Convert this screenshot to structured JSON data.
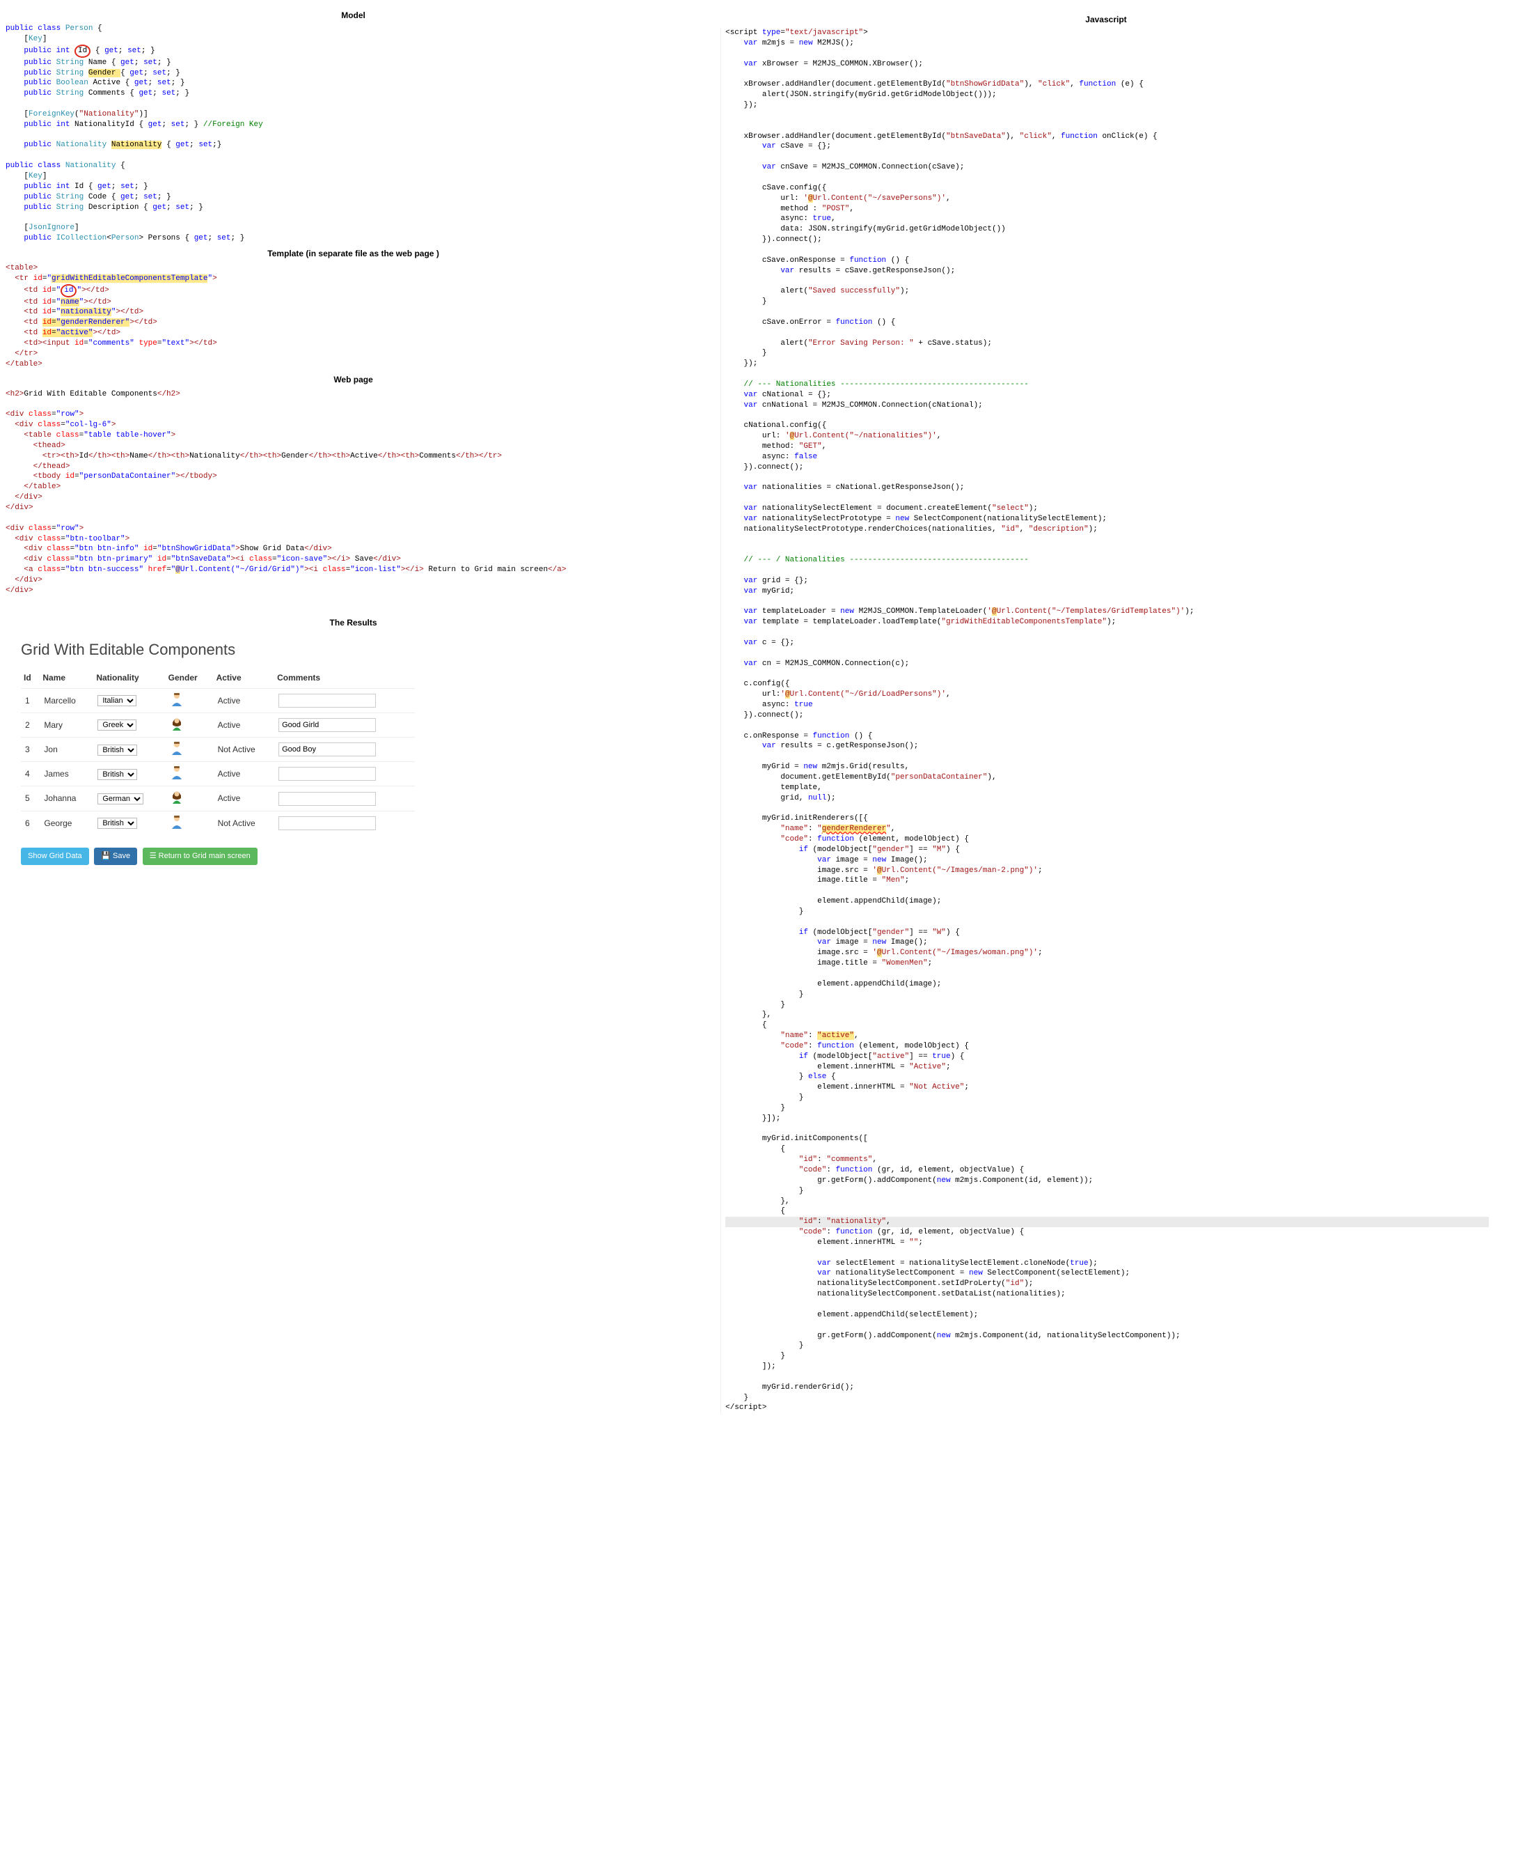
{
  "headings": {
    "model": "Model",
    "template": "Template (in separate file as the web page )",
    "webpage": "Web page",
    "results": "The Results",
    "javascript": "Javascript"
  },
  "model_code": {
    "l1": "public class Person {",
    "l2": "    [Key]",
    "l3a": "    public int ",
    "l3id": "Id",
    "l3b": " { get; set; }",
    "l4": "    public String Name { get; set; }",
    "l5a": "    public String ",
    "l5g": "Gender ",
    "l5b": "{ get; set; }",
    "l6": "    public Boolean Active { get; set; }",
    "l7": "    public String Comments { get; set; }",
    "l8": "    [ForeignKey(\"Nationality\")]",
    "l9": "    public int NationalityId { get; set; } //Foreign Key",
    "l10a": "    public Nationality ",
    "l10b": "Nationality",
    "l10c": " { get; set;}",
    "l11": "public class Nationality {",
    "l12": "    [Key]",
    "l13": "    public int Id { get; set; }",
    "l14": "    public String Code { get; set; }",
    "l15": "    public String Description { get; set; }",
    "l16": "    [JsonIgnore]",
    "l17": "    public ICollection<Person> Persons { get; set; }"
  },
  "template_code": {
    "t1": "<table>",
    "t2": "  <tr id=\"gridWithEditableComponentsTemplate\">",
    "t3a": "    <td id=\"",
    "t3id": "id",
    "t3b": "\"></td>",
    "t4": "    <td id=\"name\"></td>",
    "t5": "    <td id=\"nationality\"></td>",
    "t6": "    <td id=\"genderRenderer\"></td>",
    "t7": "    <td id=\"active\"></td>",
    "t8": "    <td><input id=\"comments\" type=\"text\"></td>",
    "t9": "  </tr>",
    "t10": "</table>"
  },
  "webpage_code": {
    "w1": "<h2>Grid With Editable Components</h2>",
    "w2": "<div class=\"row\">",
    "w3": "  <div class=\"col-lg-6\">",
    "w4": "    <table class=\"table table-hover\">",
    "w5": "      <thead>",
    "w6": "        <tr><th>Id</th><th>Name</th><th>Nationality</th><th>Gender</th><th>Active</th><th>Comments</th></tr>",
    "w7": "      </thead>",
    "w8": "      <tbody id=\"personDataContainer\"></tbody>",
    "w9": "    </table>",
    "w10": "  </div>",
    "w11": "</div>",
    "w12": "<div class=\"row\">",
    "w13": "  <div class=\"btn-toolbar\">",
    "w14": "    <div class=\"btn btn-info\" id=\"btnShowGridData\">Show Grid Data</div>",
    "w15": "    <div class=\"btn btn-primary\" id=\"btnSaveData\"><i class=\"icon-save\"></i> Save</div>",
    "w16": "    <a class=\"btn btn-success\" href=\"@Url.Content(\"~/Grid/Grid\")\"><i class=\"icon-list\"></i> Return to Grid main screen</a>",
    "w17": "  </div>",
    "w18": "</div>"
  },
  "results": {
    "title": "Grid With Editable Components",
    "columns": [
      "Id",
      "Name",
      "Nationality",
      "Gender",
      "Active",
      "Comments"
    ],
    "rows": [
      {
        "id": "1",
        "name": "Marcello",
        "nat": "Italian",
        "gender": "M",
        "active": "Active",
        "comment": ""
      },
      {
        "id": "2",
        "name": "Mary",
        "nat": "Greek",
        "gender": "W",
        "active": "Active",
        "comment": "Good Girld"
      },
      {
        "id": "3",
        "name": "Jon",
        "nat": "British",
        "gender": "M",
        "active": "Not Active",
        "comment": "Good Boy"
      },
      {
        "id": "4",
        "name": "James",
        "nat": "British",
        "gender": "M",
        "active": "Active",
        "comment": ""
      },
      {
        "id": "5",
        "name": "Johanna",
        "nat": "German",
        "gender": "W",
        "active": "Active",
        "comment": ""
      },
      {
        "id": "6",
        "name": "George",
        "nat": "British",
        "gender": "M",
        "active": "Not Active",
        "comment": ""
      }
    ],
    "buttons": {
      "show": "Show Grid Data",
      "save": " Save",
      "return": " Return to Grid main screen"
    }
  },
  "js_code": {
    "L": [
      "<script type=\"text/javascript\">",
      "    var m2mjs = new M2MJS();",
      "",
      "    var xBrowser = M2MJS_COMMON.XBrowser();",
      "",
      "    xBrowser.addHandler(document.getElementById(\"btnShowGridData\"), \"click\", function (e) {",
      "        alert(JSON.stringify(myGrid.getGridModelObject()));",
      "    });",
      "",
      "",
      "    xBrowser.addHandler(document.getElementById(\"btnSaveData\"), \"click\", function onClick(e) {",
      "        var cSave = {};",
      "",
      "        var cnSave = M2MJS_COMMON.Connection(cSave);",
      "",
      "        cSave.config({",
      "            url: '@Url.Content(\"~/savePersons\")',",
      "            method : \"POST\",",
      "            async: true,",
      "            data: JSON.stringify(myGrid.getGridModelObject())",
      "        }).connect();",
      "",
      "        cSave.onResponse = function () {",
      "            var results = cSave.getResponseJson();",
      "",
      "            alert(\"Saved successfully\");",
      "        }",
      "",
      "        cSave.onError = function () {",
      "",
      "            alert(\"Error Saving Person: \" + cSave.status);",
      "        }",
      "    });",
      "",
      "    // --- Nationalities -----------------------------------------",
      "    var cNational = {};",
      "    var cnNational = M2MJS_COMMON.Connection(cNational);",
      "",
      "    cNational.config({",
      "        url: '@Url.Content(\"~/nationalities\")',",
      "        method: \"GET\",",
      "        async: false",
      "    }).connect();",
      "",
      "    var nationalities = cNational.getResponseJson();",
      "",
      "    var nationalitySelectElement = document.createElement(\"select\");",
      "    var nationalitySelectPrototype = new SelectComponent(nationalitySelectElement);",
      "    nationalitySelectPrototype.renderChoices(nationalities, \"id\", \"description\");",
      "",
      "",
      "    // --- / Nationalities ---------------------------------------",
      "",
      "    var grid = {};",
      "    var myGrid;",
      "",
      "    var templateLoader = new M2MJS_COMMON.TemplateLoader('@Url.Content(\"~/Templates/GridTemplates\")');",
      "    var template = templateLoader.loadTemplate(\"gridWithEditableComponentsTemplate\");",
      "",
      "    var c = {};",
      "",
      "    var cn = M2MJS_COMMON.Connection(c);",
      "",
      "    c.config({",
      "        url:'@Url.Content(\"~/Grid/LoadPersons\")',",
      "        async: true",
      "    }).connect();",
      "",
      "    c.onResponse = function () {",
      "        var results = c.getResponseJson();",
      "",
      "        myGrid = new m2mjs.Grid(results,",
      "            document.getElementById(\"personDataContainer\"),",
      "            template,",
      "            grid, null);",
      "",
      "        myGrid.initRenderers([{",
      "            \"name\": \"genderRenderer\",",
      "            \"code\": function (element, modelObject) {",
      "                if (modelObject[\"gender\"] == \"M\") {",
      "                    var image = new Image();",
      "                    image.src = '@Url.Content(\"~/Images/man-2.png\")';",
      "                    image.title = \"Men\";",
      "",
      "                    element.appendChild(image);",
      "                }",
      "",
      "                if (modelObject[\"gender\"] == \"W\") {",
      "                    var image = new Image();",
      "                    image.src = '@Url.Content(\"~/Images/woman.png\")';",
      "                    image.title = \"WomenMen\";",
      "",
      "                    element.appendChild(image);",
      "                }",
      "            }",
      "        },",
      "        {",
      "            \"name\": \"active\",",
      "            \"code\": function (element, modelObject) {",
      "                if (modelObject[\"active\"] == true) {",
      "                    element.innerHTML = \"Active\";",
      "                } else {",
      "                    element.innerHTML = \"Not Active\";",
      "                }",
      "            }",
      "        }]);",
      "",
      "        myGrid.initComponents([",
      "            {",
      "                \"id\": \"comments\",",
      "                \"code\": function (gr, id, element, objectValue) {",
      "                    gr.getForm().addComponent(new m2mjs.Component(id, element));",
      "                }",
      "            },",
      "            {",
      "                \"id\": \"nationality\",",
      "                \"code\": function (gr, id, element, objectValue) {",
      "                    element.innerHTML = \"\";",
      "",
      "                    var selectElement = nationalitySelectElement.cloneNode(true);",
      "                    var nationalitySelectComponent = new SelectComponent(selectElement);",
      "                    nationalitySelectComponent.setIdProLerty(\"id\");",
      "                    nationalitySelectComponent.setDataList(nationalities);",
      "",
      "                    element.appendChild(selectElement);",
      "",
      "                    gr.getForm().addComponent(new m2mjs.Component(id, nationalitySelectComponent));",
      "                }",
      "            }",
      "        ]);",
      "",
      "        myGrid.renderGrid();",
      "    }",
      "</script>"
    ]
  }
}
